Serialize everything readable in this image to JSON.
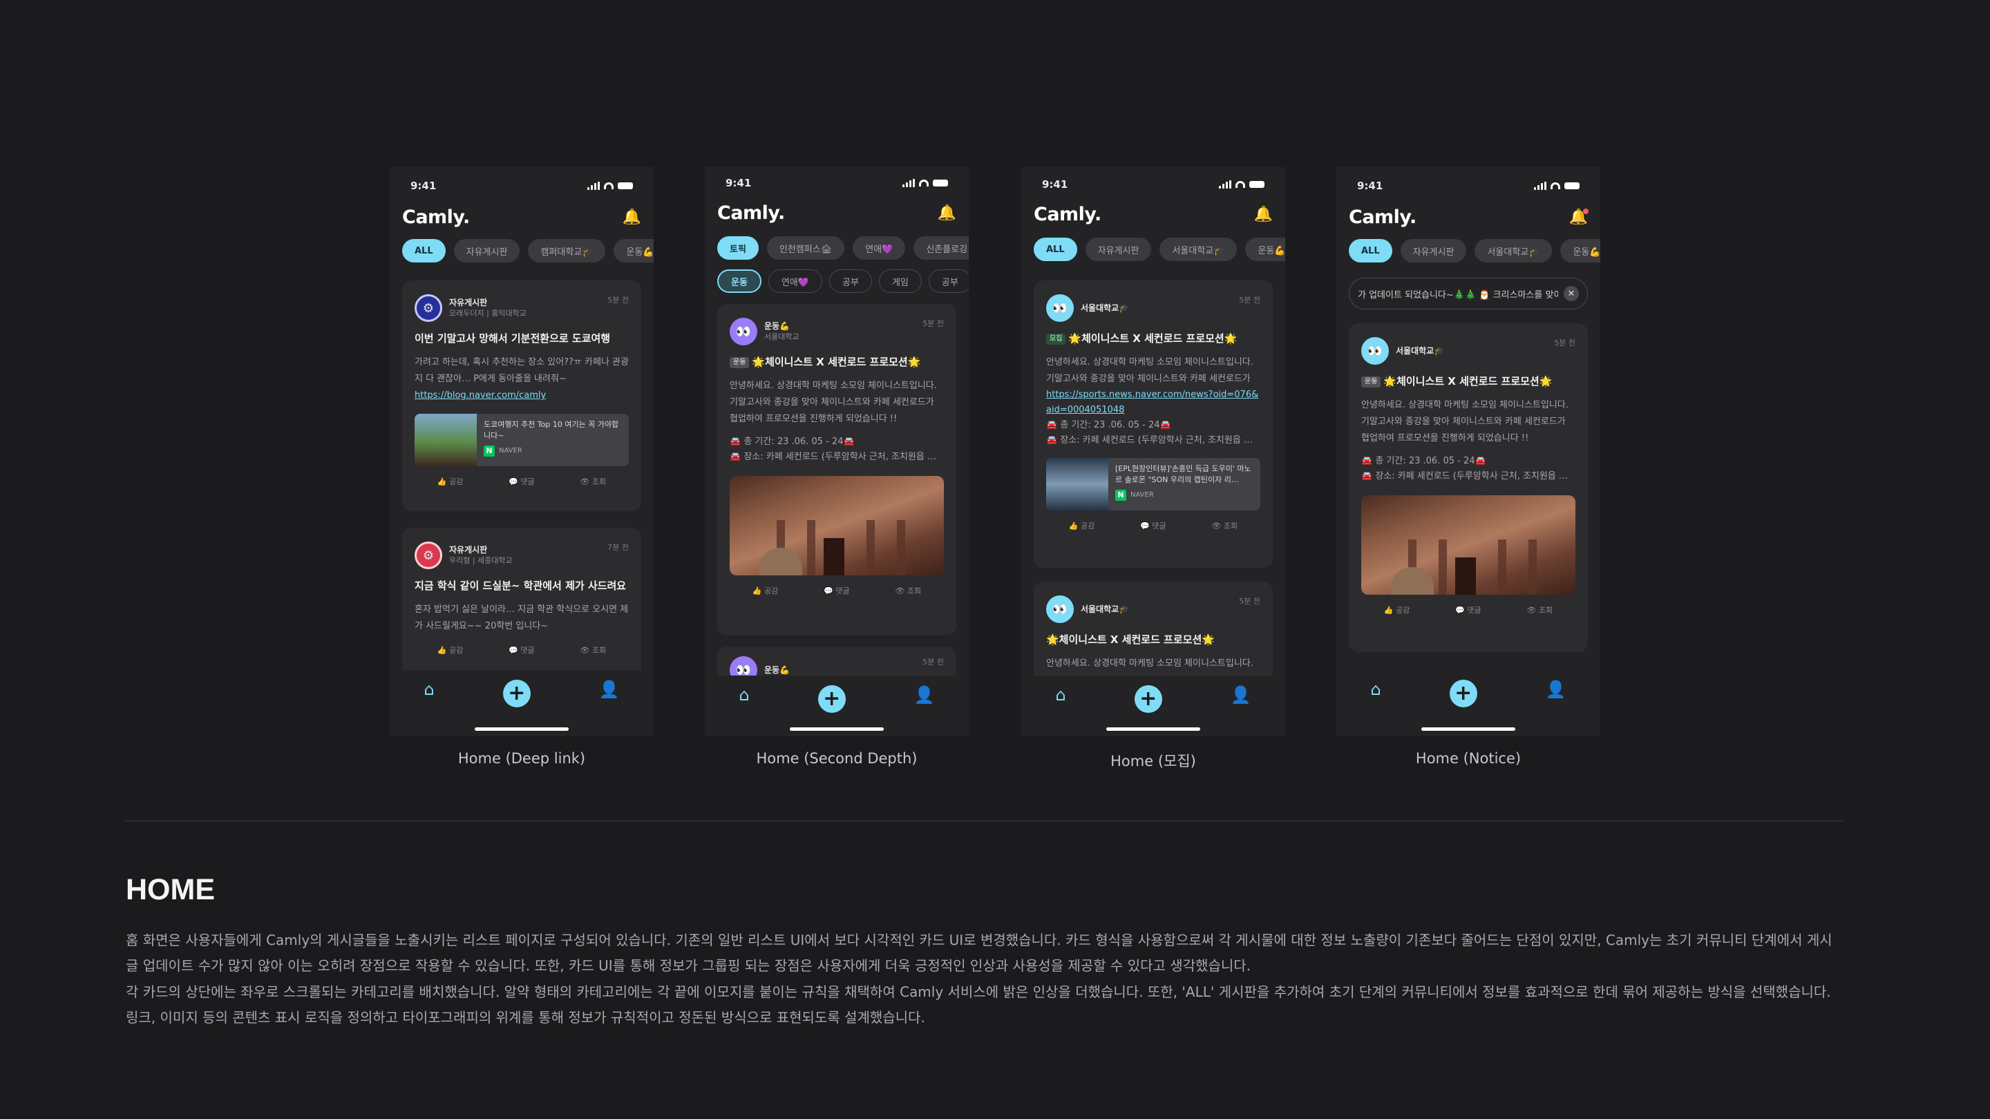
{
  "status_time": "9:41",
  "app_logo": "Camly.",
  "tab_icons": [
    "home-icon",
    "plus-icon",
    "profile-icon"
  ],
  "screens": [
    {
      "caption": "Home (Deep link)",
      "chips": [
        "ALL",
        "자유게시판",
        "캠퍼대학교🎓",
        "운동💪"
      ],
      "card1": {
        "board": "자유게시판",
        "author": "모래두더지 | 홍익대학교",
        "time": "5분 전",
        "title": "이번 기말고사 망해서 기분전환으로 도쿄여행",
        "body": "가려고 하는데, 혹시 추천하는 장소 있어??ㅠ 카페나 관광지 다 괜찮아… P에게 동아줄을 내려줘~",
        "link": "https://blog.naver.com/camly",
        "link_title": "도쿄여행지 추천 Top 10 여기는 꼭 가야합니다~",
        "link_source": "NAVER",
        "actions": [
          "공감",
          "댓글",
          "조회"
        ]
      },
      "card2": {
        "board": "자유게시판",
        "author": "우리형 | 세종대학교",
        "time": "7분 전",
        "title": "지금 학식 같이 드실분~ 학관에서 제가 사드려요",
        "body": "혼자 밥먹기 싫은 날이라… 지금 학관 학식으로 오시면 제가 사드릴게요~~ 20학번 입니다~",
        "actions": [
          "공감",
          "댓글",
          "조회"
        ]
      }
    },
    {
      "caption": "Home (Second Depth)",
      "chips": [
        "토픽",
        "인천캠퍼스🏚",
        "연애💜",
        "신촌플로깅🏖"
      ],
      "subchips": [
        "운동",
        "연애💜",
        "공부",
        "게임",
        "공부"
      ],
      "card1": {
        "board": "운동💪",
        "author": "서울대학교",
        "time": "5분 전",
        "tag": "운동",
        "title": "🌟체이니스트 X 세컨로드 프로모션🌟",
        "body": "안녕하세요. 상경대학 마케팅 소모임 체이니스트입니다. 기말고사와 종강을 맞아 체이니스트와 카페 세컨로드가 협업하여 프로모션을 진행하게 되었습니다 !!",
        "period": "🚘 총 기간: 23 .06. 05 - 24🚘",
        "place": "🚘 장소: 카페 세컨로드 (두루암학사 근처, 조치원읍 …",
        "actions": [
          "공감",
          "댓글",
          "조회"
        ]
      },
      "card2": {
        "board": "운동💪",
        "time": "5분 전"
      }
    },
    {
      "caption": "Home (모집)",
      "chips": [
        "ALL",
        "자유게시판",
        "서울대학교🎓",
        "운동💪"
      ],
      "card1": {
        "board": "서울대학교🎓",
        "time": "5분 전",
        "tag": "모집",
        "title": "🌟체이니스트 X 세컨로드 프로모션🌟",
        "body": "안녕하세요. 상경대학 마케팅 소모임 체이니스트입니다. 기말고사와 종강을 맞아 체이니스트와 카페 세컨로드가",
        "link": "https://sports.news.naver.com/news?oid=076&aid=0004051048",
        "period": "🚘 총 기간: 23 .06. 05 - 24🚘",
        "place": "🚘 장소: 카페 세컨로드 (두루암학사 근처, 조치원읍 …",
        "link_title": "[EPL현장인터뷰]'손흥민 득급 도우미' 마노르 솔로몬 \"SON 우리의 캡틴이자 리…",
        "link_source": "NAVER",
        "actions": [
          "공감",
          "댓글",
          "조회"
        ]
      },
      "card2": {
        "board": "서울대학교🎓",
        "time": "5분 전",
        "title": "🌟체이니스트 X 세컨로드 프로모션🌟",
        "body": "안녕하세요. 상경대학 마케팅 소모임 체이니스트입니다."
      }
    },
    {
      "caption": "Home (Notice)",
      "chips": [
        "ALL",
        "자유게시판",
        "서울대학교🎓",
        "운동💪"
      ],
      "notice": "가 업데이트 되었습니다~🎄🎄 🎅 크리스마스를 맞이",
      "card1": {
        "board": "서울대학교🎓",
        "time": "5분 전",
        "tag": "운동",
        "title": "🌟체이니스트 X 세컨로드 프로모션🌟",
        "body": "안녕하세요. 상경대학 마케팅 소모임 체이니스트입니다. 기말고사와 종강을 맞아 체이니스트와 카페 세컨로드가 협업하여 프로모션을 진행하게 되었습니다 !!",
        "period": "🚘 총 기간: 23 .06. 05 - 24🚘",
        "place": "🚘 장소: 카페 세컨로드 (두루암학사 근처, 조치원읍 …",
        "actions": [
          "공감",
          "댓글",
          "조회"
        ]
      }
    }
  ],
  "section": {
    "title": "HOME",
    "p1": "홈 화면은 사용자들에게 Camly의 게시글들을 노출시키는 리스트 페이지로 구성되어 있습니다. 기존의 일반 리스트 UI에서 보다 시각적인 카드 UI로 변경했습니다. 카드 형식을 사용함으로써 각 게시물에 대한 정보 노출량이 기존보다 줄어드는 단점이 있지만, Camly는 초기 커뮤니티 단계에서 게시글 업데이트 수가 많지 않아 이는 오히려 장점으로 작용할 수 있습니다. 또한, 카드 UI를 통해 정보가 그룹핑 되는 장점은 사용자에게 더욱 긍정적인 인상과 사용성을 제공할 수 있다고 생각했습니다.",
    "p2": "각 카드의 상단에는 좌우로 스크롤되는 카테고리를 배치했습니다. 알약 형태의 카테고리에는 각 끝에 이모지를 붙이는 규칙을 채택하여 Camly 서비스에 밝은 인상을 더했습니다. 또한, 'ALL' 게시판을 추가하여 초기 단계의 커뮤니티에서 정보를 효과적으로 한데 묶어 제공하는 방식을 선택했습니다. 링크, 이미지 등의 콘텐츠 표시 로직을 정의하고 타이포그래피의 위계를 통해 정보가 규칙적이고 정돈된 방식으로 표현되도록 설계했습니다."
  }
}
